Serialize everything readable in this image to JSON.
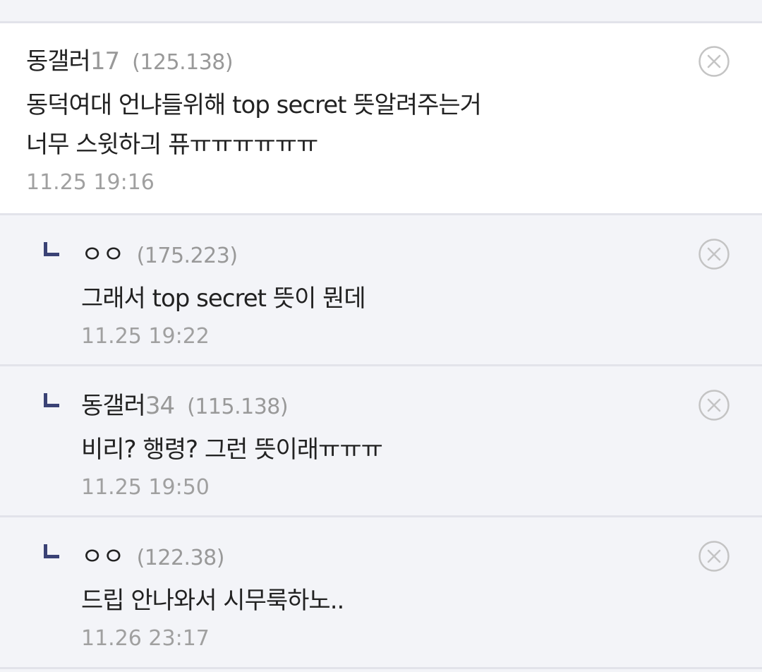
{
  "comments": [
    {
      "nick": "동갤러",
      "nick_num": "17",
      "ip": "(125.138)",
      "text": "동덕여대 언냐들위해 top secret 뜻알려주는거\n너무 스윗하긔 퓨ㅠㅠㅠㅠㅠㅠ",
      "time": "11.25 19:16"
    },
    {
      "nick": "ㅇㅇ",
      "nick_num": "",
      "ip": "(175.223)",
      "text": "그래서 top secret 뜻이 뭔데",
      "time": "11.25 19:22"
    },
    {
      "nick": "동갤러",
      "nick_num": "34",
      "ip": "(115.138)",
      "text": "비리? 행령? 그런 뜻이래ㅠㅠㅠ",
      "time": "11.25 19:50"
    },
    {
      "nick": "ㅇㅇ",
      "nick_num": "",
      "ip": "(122.38)",
      "text": "드립 안나와서 시무룩하노..",
      "time": "11.26 23:17"
    }
  ],
  "icons": {
    "delete": "close-circle-icon",
    "reply": "reply-arrow-icon"
  },
  "colors": {
    "reply_mark": "#3a4275",
    "meta_gray": "#999999",
    "main_bg": "#ffffff",
    "reply_bg": "#f3f4f8"
  }
}
